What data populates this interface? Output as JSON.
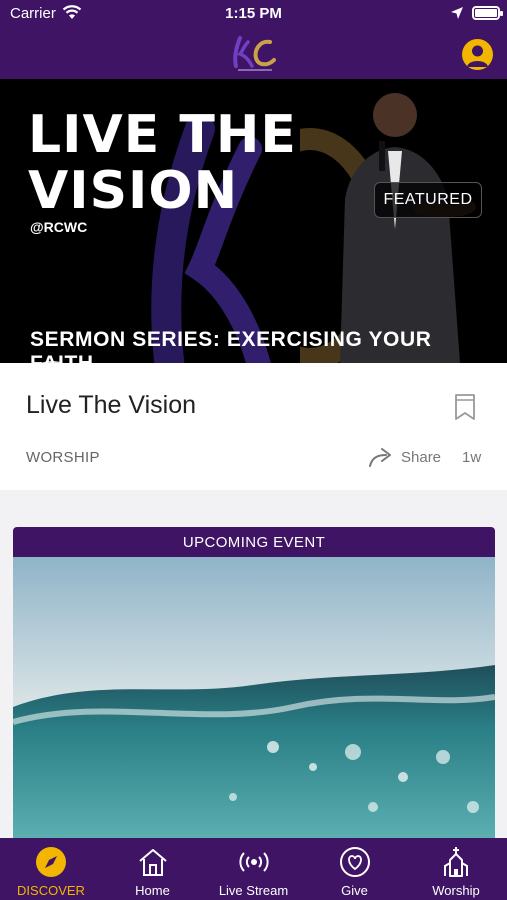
{
  "status_bar": {
    "carrier": "Carrier",
    "time": "1:15 PM"
  },
  "header": {
    "logo_icon": "church-logo",
    "profile_icon": "user-avatar-icon",
    "accent": "#3f1464",
    "highlight": "#f2b600"
  },
  "featured": {
    "title_line1": "LIVE THE",
    "title_line2": "VISION",
    "handle": "@RCWC",
    "badge": "FEATURED",
    "series": "SERMON SERIES: EXERCISING YOUR FAITH.",
    "play_icon": "youtube-play-icon"
  },
  "card": {
    "title": "Live The Vision",
    "category": "WORSHIP",
    "share_label": "Share",
    "age": "1w",
    "bookmark_icon": "bookmark-icon",
    "share_icon": "share-arrow-icon"
  },
  "event": {
    "header": "UPCOMING EVENT",
    "image_subject": "water-wave-image"
  },
  "tabs": [
    {
      "label": "DISCOVER",
      "icon": "compass-icon",
      "active": true
    },
    {
      "label": "Home",
      "icon": "home-icon",
      "active": false
    },
    {
      "label": "Live Stream",
      "icon": "broadcast-icon",
      "active": false
    },
    {
      "label": "Give",
      "icon": "heart-icon",
      "active": false
    },
    {
      "label": "Worship",
      "icon": "church-icon",
      "active": false
    }
  ]
}
